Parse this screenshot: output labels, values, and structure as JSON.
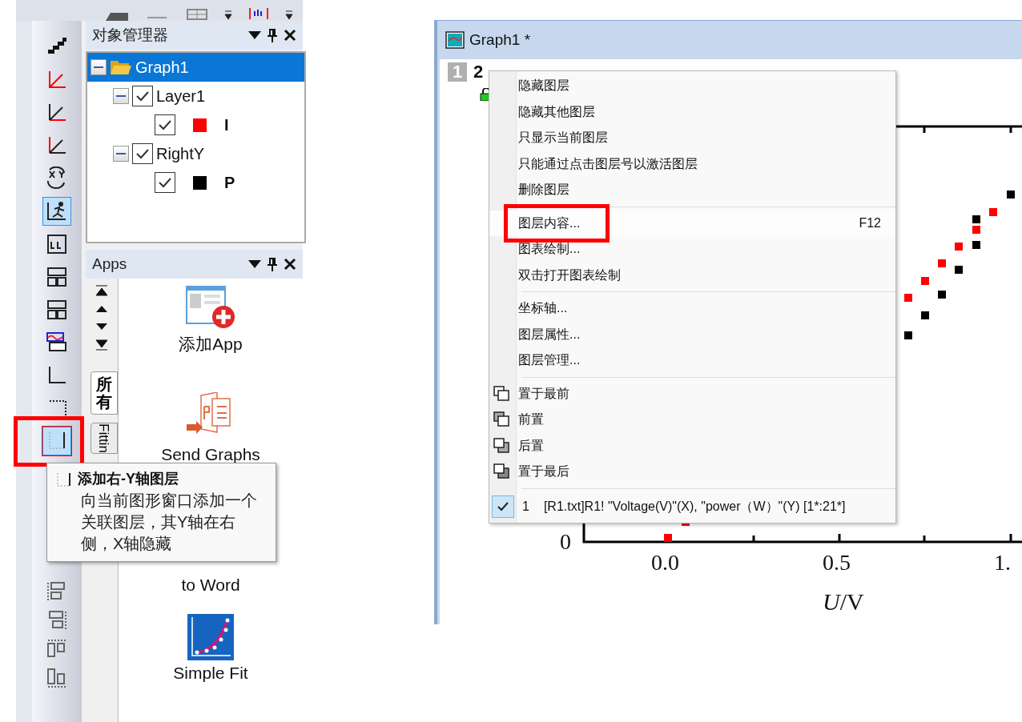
{
  "toolbar": {
    "buttons": [
      {
        "kind": "stack",
        "selected": false,
        "highlighted": false
      },
      {
        "kind": "axes-red",
        "selected": false,
        "highlighted": false
      },
      {
        "kind": "axes-x",
        "selected": false,
        "highlighted": false
      },
      {
        "kind": "axes-y",
        "selected": false,
        "highlighted": false
      },
      {
        "kind": "swap",
        "selected": false,
        "highlighted": false
      },
      {
        "kind": "runner",
        "selected": true,
        "highlighted": false
      },
      {
        "kind": "layer-one",
        "selected": false,
        "highlighted": false
      },
      {
        "kind": "layer-four",
        "selected": false,
        "highlighted": false
      },
      {
        "kind": "layer-four",
        "selected": false,
        "highlighted": false
      },
      {
        "kind": "merge",
        "selected": false,
        "highlighted": false
      },
      {
        "kind": "axis-bottom",
        "selected": false,
        "highlighted": false
      },
      {
        "kind": "axis-top",
        "selected": false,
        "highlighted": false
      },
      {
        "kind": "axis-right",
        "selected": true,
        "highlighted": true
      }
    ],
    "align_buttons": [
      {
        "kind": "align-left"
      },
      {
        "kind": "align-right"
      },
      {
        "kind": "align-top"
      },
      {
        "kind": "align-bottom"
      }
    ]
  },
  "tooltip": {
    "title": "添加右-Y轴图层",
    "body": "向当前图形窗口添加一个关联图层，其Y轴在右侧，X轴隐藏"
  },
  "object_manager": {
    "title": "对象管理器",
    "tree": [
      {
        "label": "Graph1",
        "selected": true,
        "expanded": true,
        "children": [
          {
            "label": "Layer1",
            "checked": true,
            "expanded": true,
            "children": [
              {
                "label": "I",
                "checked": true,
                "color": "#ff0000"
              }
            ]
          },
          {
            "label": "RightY",
            "checked": true,
            "expanded": true,
            "children": [
              {
                "label": "P",
                "checked": true,
                "color": "#000000"
              }
            ]
          }
        ]
      }
    ]
  },
  "apps": {
    "title": "Apps",
    "tabs": [
      {
        "label": "所有",
        "selected": true
      },
      {
        "label": "Fittin",
        "selected": false
      }
    ],
    "items": [
      {
        "kind": "add",
        "label": "添加App"
      },
      {
        "kind": "powerpoint",
        "label": "Send Graphs"
      },
      {
        "kind": "word",
        "label": "to Word"
      },
      {
        "kind": "fit",
        "label": "Simple Fit"
      }
    ]
  },
  "graph": {
    "title": "Graph1 *",
    "layers": [
      {
        "label": "1",
        "selected": false
      },
      {
        "label": "2",
        "selected": true
      }
    ],
    "menu": [
      {
        "kind": "item",
        "label": "隐藏图层",
        "highlighted": false
      },
      {
        "kind": "item",
        "label": "隐藏其他图层",
        "highlighted": false
      },
      {
        "kind": "item",
        "label": "只显示当前图层",
        "highlighted": false
      },
      {
        "kind": "item",
        "label": "只能通过点击图层号以激活图层",
        "highlighted": false
      },
      {
        "kind": "item",
        "label": "删除图层",
        "highlighted": false
      },
      {
        "kind": "separator"
      },
      {
        "kind": "item",
        "label": "图层内容...",
        "shortcut": "F12",
        "highlighted": true
      },
      {
        "kind": "item",
        "label": "图表绘制...",
        "highlighted": false
      },
      {
        "kind": "item",
        "label": "双击打开图表绘制",
        "highlighted": false
      },
      {
        "kind": "separator"
      },
      {
        "kind": "item",
        "label": "坐标轴...",
        "highlighted": false
      },
      {
        "kind": "item",
        "label": "图层属性...",
        "highlighted": false
      },
      {
        "kind": "item",
        "label": "图层管理...",
        "highlighted": false
      },
      {
        "kind": "separator"
      },
      {
        "kind": "order",
        "label": "置于最前",
        "highlighted": false
      },
      {
        "kind": "order",
        "label": "前置",
        "highlighted": false
      },
      {
        "kind": "order",
        "label": "后置",
        "highlighted": false
      },
      {
        "kind": "order",
        "label": "置于最后",
        "highlighted": false
      },
      {
        "kind": "separator"
      },
      {
        "kind": "plot",
        "number": "1",
        "label": "[R1.txt]R1! \"Voltage(V)\"(X), \"power（W）\"(Y) [1*:21*]",
        "checked": true
      }
    ],
    "y_tick": "0",
    "x_ticks": [
      "0.0",
      "0.5",
      "1."
    ],
    "xlabel": "*U*/V"
  }
}
